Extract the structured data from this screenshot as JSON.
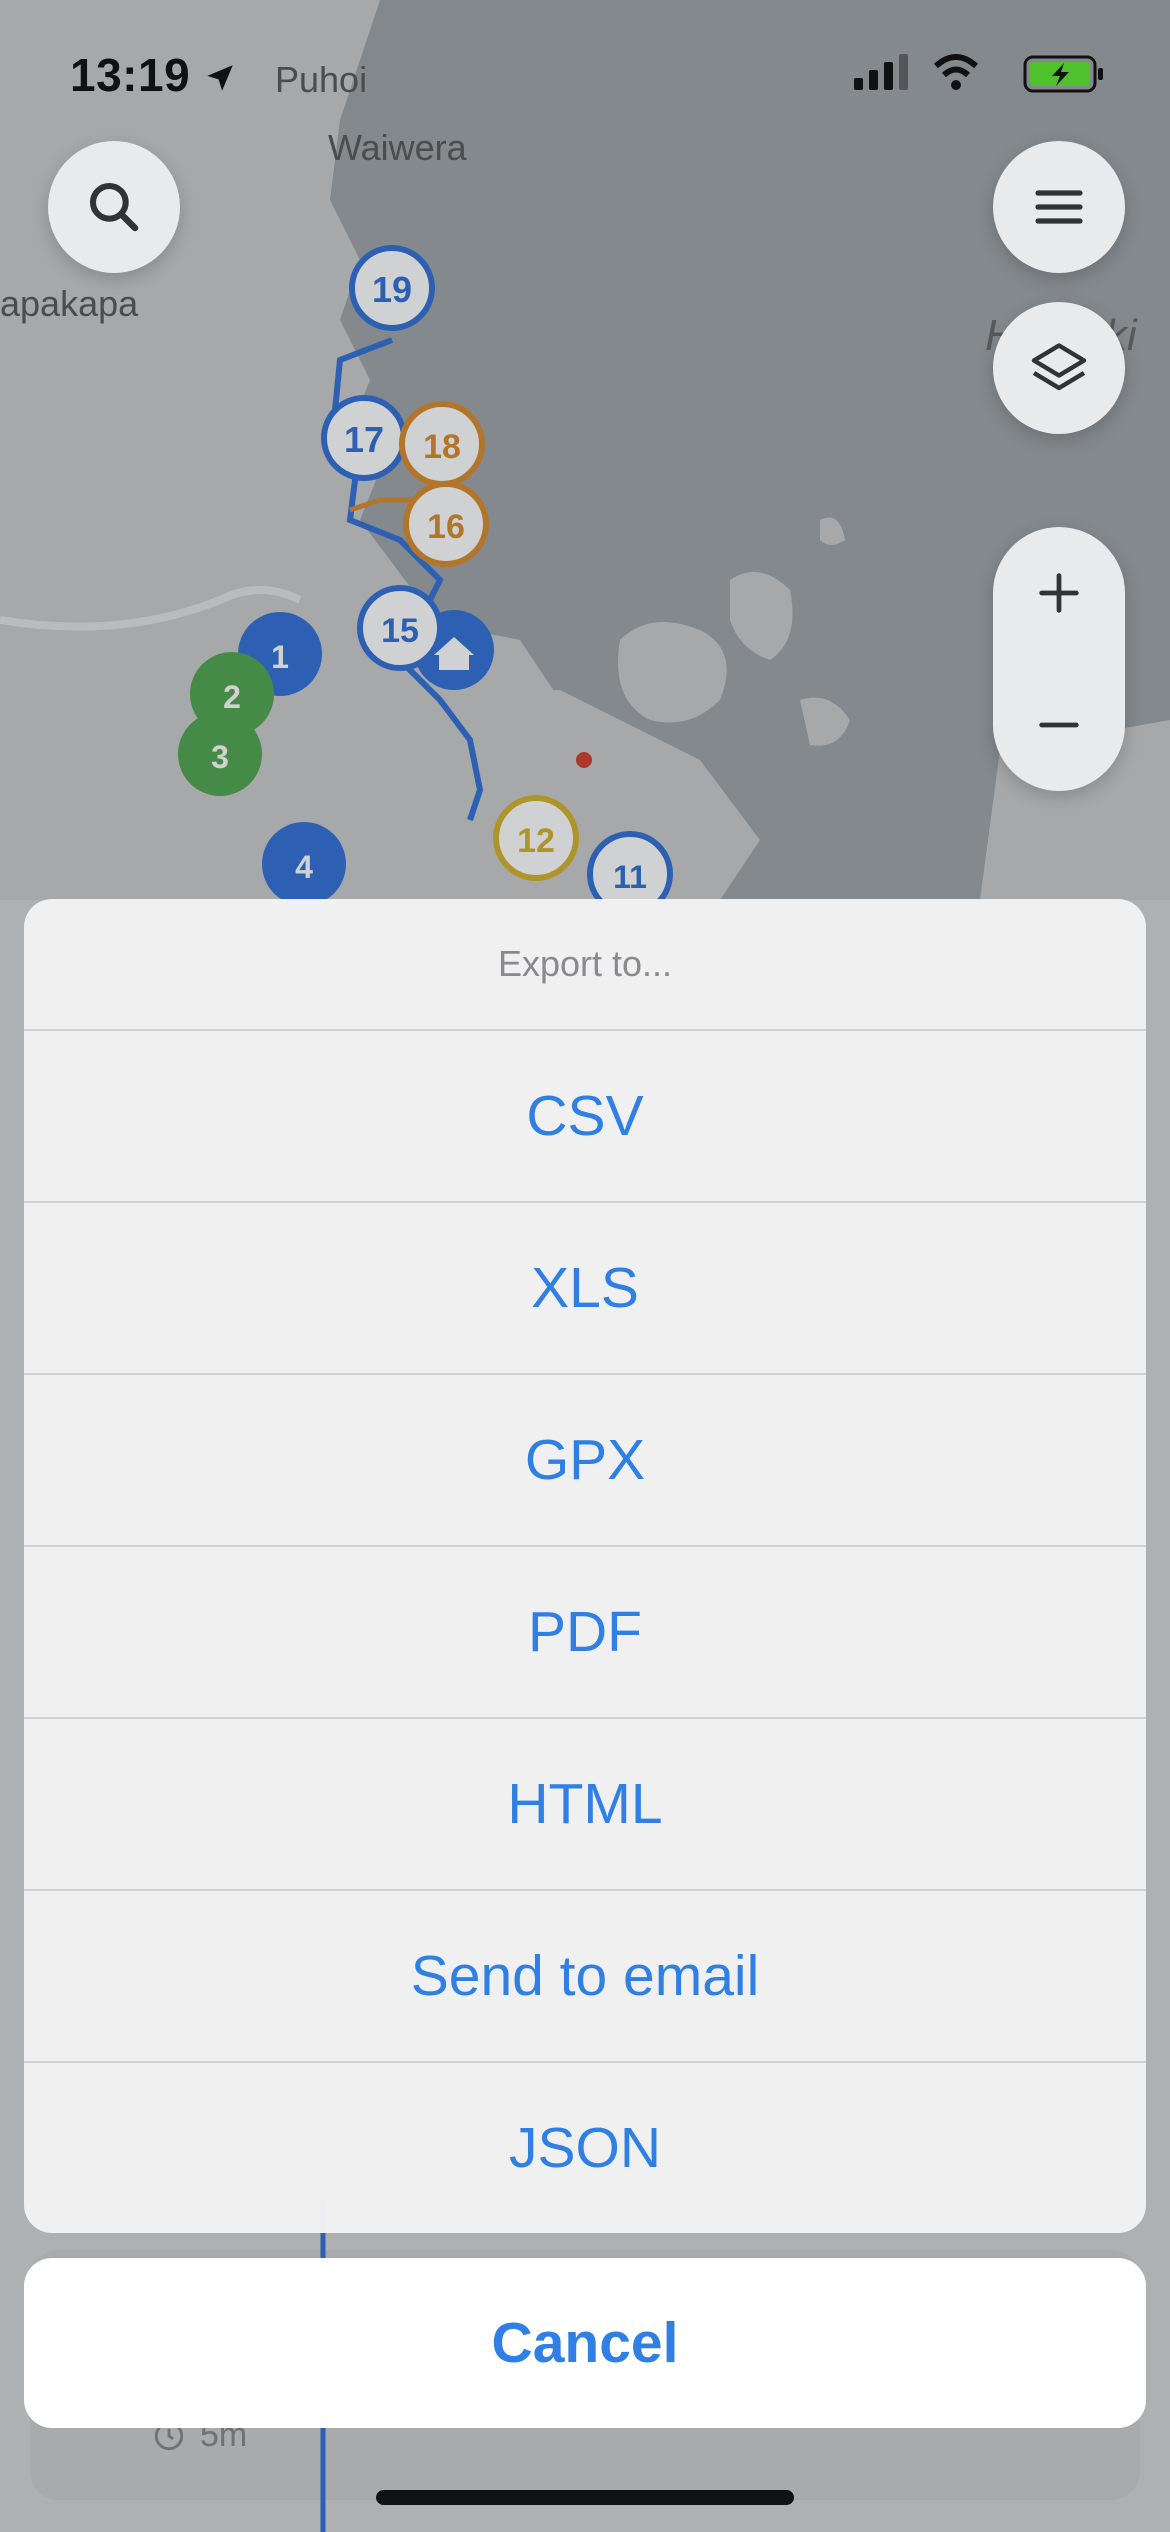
{
  "status_bar": {
    "time": "13:19"
  },
  "map": {
    "place_labels": [
      "Puhoi",
      "Waiwera",
      "apakapa",
      "Hauraki"
    ],
    "markers": [
      {
        "label": "19",
        "color": "#2f6fd6"
      },
      {
        "label": "17",
        "color": "#2f6fd6"
      },
      {
        "label": "18",
        "color": "#d98a2b"
      },
      {
        "label": "16",
        "color": "#d98a2b"
      },
      {
        "label": "15",
        "color": "#2f6fd6"
      },
      {
        "label": "1",
        "color": "#2f6fd6"
      },
      {
        "label": "2",
        "color": "#4ea44e"
      },
      {
        "label": "3",
        "color": "#4ea44e"
      },
      {
        "label": "4",
        "color": "#2f6fd6"
      },
      {
        "label": "12",
        "color": "#d4b22a"
      },
      {
        "label": "11",
        "color": "#2f6fd6"
      }
    ]
  },
  "controls": {
    "search_icon": "search-icon",
    "menu_icon": "hamburger-icon",
    "layers_icon": "layers-icon",
    "zoom_in_icon": "plus-icon",
    "zoom_out_icon": "minus-icon"
  },
  "action_sheet": {
    "title": "Export to...",
    "options": [
      "CSV",
      "XLS",
      "GPX",
      "PDF",
      "HTML",
      "Send to email",
      "JSON"
    ],
    "cancel_label": "Cancel"
  },
  "background_panel": {
    "duration": "5m"
  },
  "colors": {
    "accent": "#2f7fe4",
    "route_blue": "#2f6fd6",
    "route_orange": "#d98a2b",
    "route_green": "#4ea44e"
  }
}
